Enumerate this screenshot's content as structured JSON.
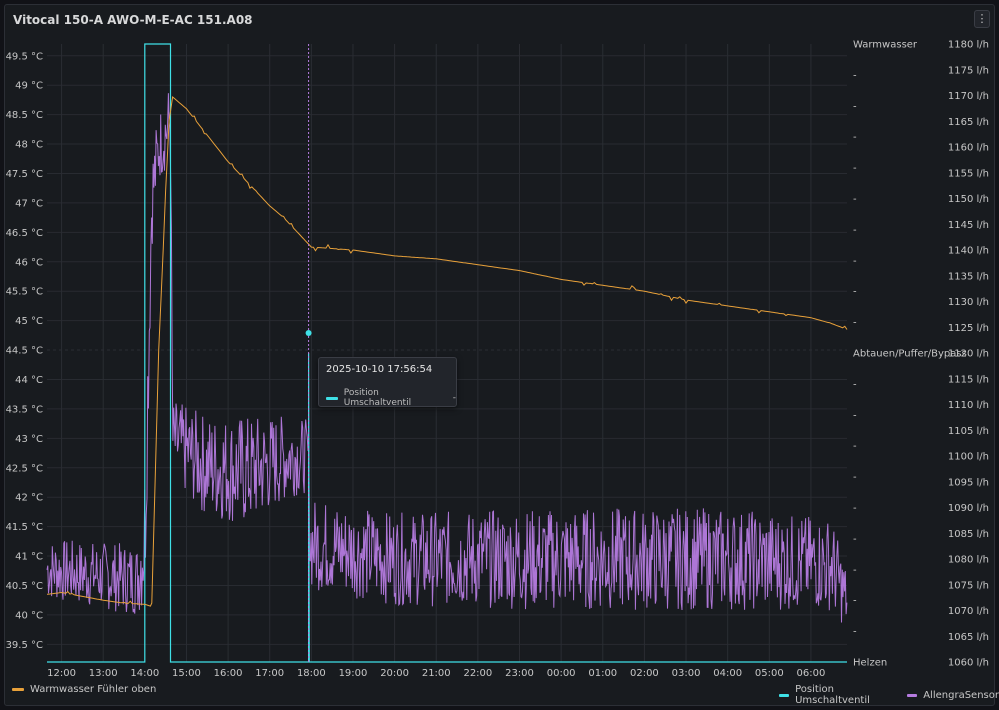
{
  "panel": {
    "title": "Vitocal 150-A AWO-M-E-AC 151.A08",
    "menu_icon": "⋮"
  },
  "colors": {
    "orange": "#e8a13a",
    "cyan": "#3fe0e6",
    "purple": "#b57be0",
    "grid": "#2a2d33",
    "text": "#c7c7c7"
  },
  "chart_data": {
    "type": "line",
    "x_ticks": [
      "12:00",
      "13:00",
      "14:00",
      "15:00",
      "16:00",
      "17:00",
      "18:00",
      "19:00",
      "20:00",
      "21:00",
      "22:00",
      "23:00",
      "00:00",
      "01:00",
      "02:00",
      "03:00",
      "04:00",
      "05:00",
      "06:00"
    ],
    "xlim": [
      "2025-10-10 11:39",
      "2025-10-11 06:52"
    ],
    "y_left": {
      "ticks": [
        "39.5 °C",
        "40 °C",
        "40.5 °C",
        "41 °C",
        "41.5 °C",
        "42 °C",
        "42.5 °C",
        "43 °C",
        "43.5 °C",
        "44 °C",
        "44.5 °C",
        "45 °C",
        "45.5 °C",
        "46 °C",
        "46.5 °C",
        "47 °C",
        "47.5 °C",
        "48 °C",
        "48.5 °C",
        "49 °C",
        "49.5 °C"
      ],
      "range": [
        39.2,
        49.7
      ]
    },
    "y_right_state": {
      "labels": [
        "Warmwasser",
        "-",
        "-",
        "-",
        "-",
        "-",
        "-",
        "-",
        "-",
        "-",
        "Abtauen/Puffer/Bypass",
        "-",
        "-",
        "-",
        "-",
        "-",
        "-",
        "-",
        "-",
        "-",
        "Helzen"
      ]
    },
    "y_right_flow": {
      "ticks": [
        "1060 l/h",
        "1065 l/h",
        "1070 l/h",
        "1075 l/h",
        "1080 l/h",
        "1085 l/h",
        "1090 l/h",
        "1095 l/h",
        "1100 l/h",
        "1105 l/h",
        "1110 l/h",
        "1115 l/h",
        "1120 l/h",
        "1125 l/h",
        "1130 l/h",
        "1135 l/h",
        "1140 l/h",
        "1145 l/h",
        "1150 l/h",
        "1155 l/h",
        "1160 l/h",
        "1165 l/h",
        "1170 l/h",
        "1175 l/h",
        "1180 l/h"
      ],
      "range": [
        1060,
        1180
      ]
    },
    "series": [
      {
        "name": "Warmwasser Fühler oben",
        "color": "#e8a13a",
        "axis": "left",
        "points": [
          [
            "11:39",
            40.35
          ],
          [
            "12:00",
            40.38
          ],
          [
            "13:00",
            40.25
          ],
          [
            "13:30",
            40.2
          ],
          [
            "14:00",
            40.18
          ],
          [
            "14:08",
            40.15
          ],
          [
            "14:10",
            40.2
          ],
          [
            "14:20",
            44.5
          ],
          [
            "14:30",
            47.2
          ],
          [
            "14:35",
            48.4
          ],
          [
            "14:40",
            48.8
          ],
          [
            "14:50",
            48.7
          ],
          [
            "15:00",
            48.6
          ],
          [
            "15:20",
            48.3
          ],
          [
            "15:40",
            48.0
          ],
          [
            "16:00",
            47.7
          ],
          [
            "16:20",
            47.45
          ],
          [
            "16:40",
            47.2
          ],
          [
            "17:00",
            46.95
          ],
          [
            "17:20",
            46.75
          ],
          [
            "17:40",
            46.5
          ],
          [
            "18:00",
            46.25
          ],
          [
            "19:00",
            46.2
          ],
          [
            "20:00",
            46.1
          ],
          [
            "21:00",
            46.05
          ],
          [
            "22:00",
            45.95
          ],
          [
            "23:00",
            45.85
          ],
          [
            "00:00",
            45.7
          ],
          [
            "01:00",
            45.6
          ],
          [
            "02:00",
            45.5
          ],
          [
            "03:00",
            45.35
          ],
          [
            "04:00",
            45.25
          ],
          [
            "05:00",
            45.15
          ],
          [
            "06:00",
            45.05
          ],
          [
            "06:30",
            44.95
          ],
          [
            "06:52",
            44.85
          ]
        ]
      },
      {
        "name": "Position Umschaltventil",
        "color": "#3fe0e6",
        "axis": "state",
        "points": [
          [
            "11:39",
            "Helzen"
          ],
          [
            "14:00",
            "Helzen"
          ],
          [
            "14:00",
            "Warmwasser"
          ],
          [
            "14:37",
            "Warmwasser"
          ],
          [
            "14:37",
            "Helzen"
          ],
          [
            "17:56",
            "Helzen"
          ],
          [
            "17:56",
            "Abtauen/Puffer/Bypass"
          ],
          [
            "17:57",
            "Helzen"
          ],
          [
            "06:52",
            "Helzen"
          ]
        ]
      },
      {
        "name": "AllengraSensor",
        "color": "#b57be0",
        "axis": "flow",
        "envelope": [
          [
            "11:39",
            1078,
            6
          ],
          [
            "13:50",
            1076,
            7
          ],
          [
            "14:00",
            1085,
            15
          ],
          [
            "14:10",
            1150,
            10
          ],
          [
            "14:20",
            1160,
            7
          ],
          [
            "14:37",
            1165,
            8
          ],
          [
            "14:40",
            1103,
            8
          ],
          [
            "15:30",
            1098,
            10
          ],
          [
            "16:30",
            1097,
            11
          ],
          [
            "17:30",
            1100,
            8
          ],
          [
            "17:56",
            1100,
            7
          ],
          [
            "17:58",
            1083,
            9
          ],
          [
            "20:00",
            1080,
            9
          ],
          [
            "00:00",
            1080,
            10
          ],
          [
            "04:00",
            1080,
            10
          ],
          [
            "06:30",
            1079,
            9
          ],
          [
            "06:52",
            1072,
            6
          ]
        ]
      }
    ],
    "legend": "bottom",
    "grid": true
  },
  "tooltip": {
    "time": "2025-10-10 17:56:54",
    "series": "Position Umschaltventil",
    "value": "-"
  },
  "legend": {
    "left": [
      {
        "label": "Warmwasser Fühler oben",
        "color": "#e8a13a"
      }
    ],
    "right": [
      {
        "label": "Position Umschaltventil",
        "color": "#3fe0e6"
      },
      {
        "label": "AllengraSensor",
        "color": "#b57be0"
      }
    ]
  }
}
